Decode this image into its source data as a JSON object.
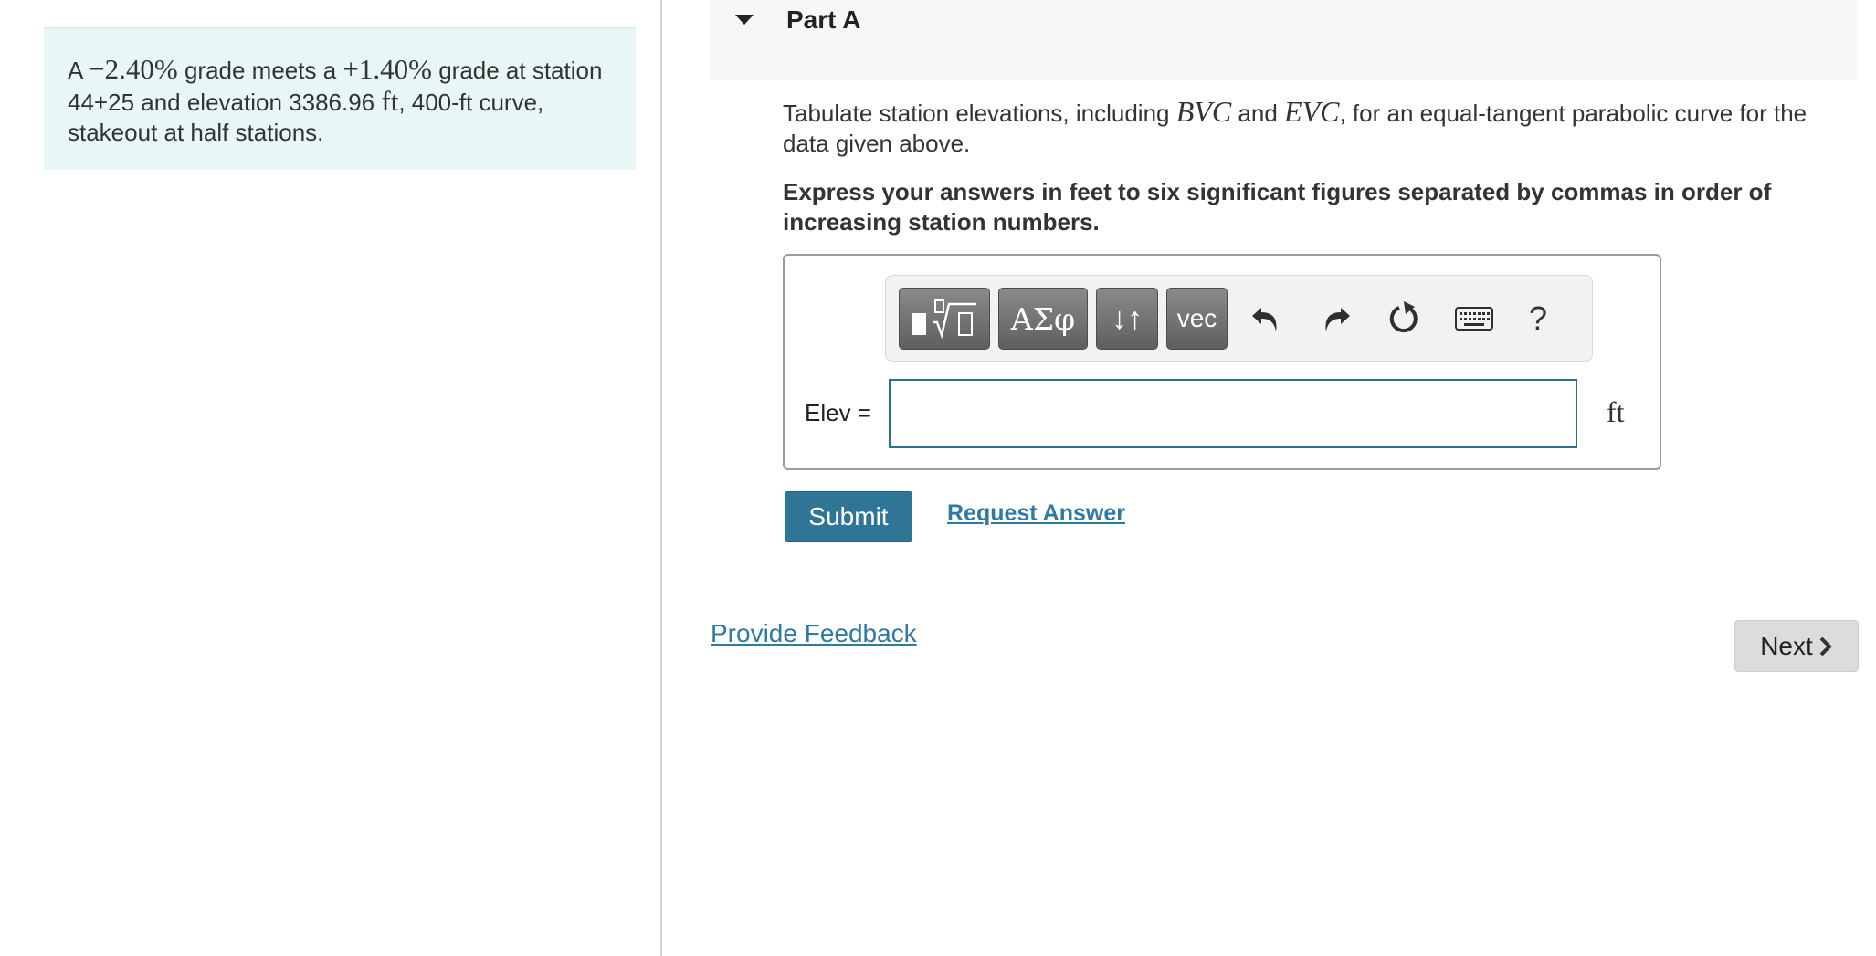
{
  "problem": {
    "prefix": "A",
    "grade1": "−2.40%",
    "text1": "grade meets a",
    "grade2": "+1.40%",
    "text2": "grade at station 44+25 and elevation 3386.96",
    "unit": "ft",
    "text3": ", 400-ft curve, stakeout at half stations."
  },
  "part": {
    "title": "Part A"
  },
  "prompt": {
    "text1": "Tabulate station elevations, including",
    "bvc": "BVC",
    "and": "and",
    "evc": "EVC",
    "text2": ", for an equal-tangent parabolic curve for the data given above."
  },
  "instruction": "Express your answers in feet to six significant figures separated by commas in order of increasing station numbers.",
  "toolbar": {
    "greek_label": "ΑΣφ",
    "arrows_label": "↓↑",
    "vec_label": "vec",
    "help_label": "?"
  },
  "answer": {
    "label": "Elev =",
    "value": "",
    "unit": "ft"
  },
  "actions": {
    "submit_label": "Submit",
    "request_label": "Request Answer",
    "feedback_label": "Provide Feedback",
    "next_label": "Next"
  },
  "colors": {
    "problem_bg": "#e8f6f6",
    "submit_bg": "#2f7696",
    "link": "#2e7aa3",
    "input_border": "#2d6f8f"
  },
  "icons": [
    "templates-icon",
    "undo-icon",
    "redo-icon",
    "reset-icon",
    "keyboard-icon",
    "help-icon",
    "chevron-right-icon",
    "caret-down-icon"
  ]
}
